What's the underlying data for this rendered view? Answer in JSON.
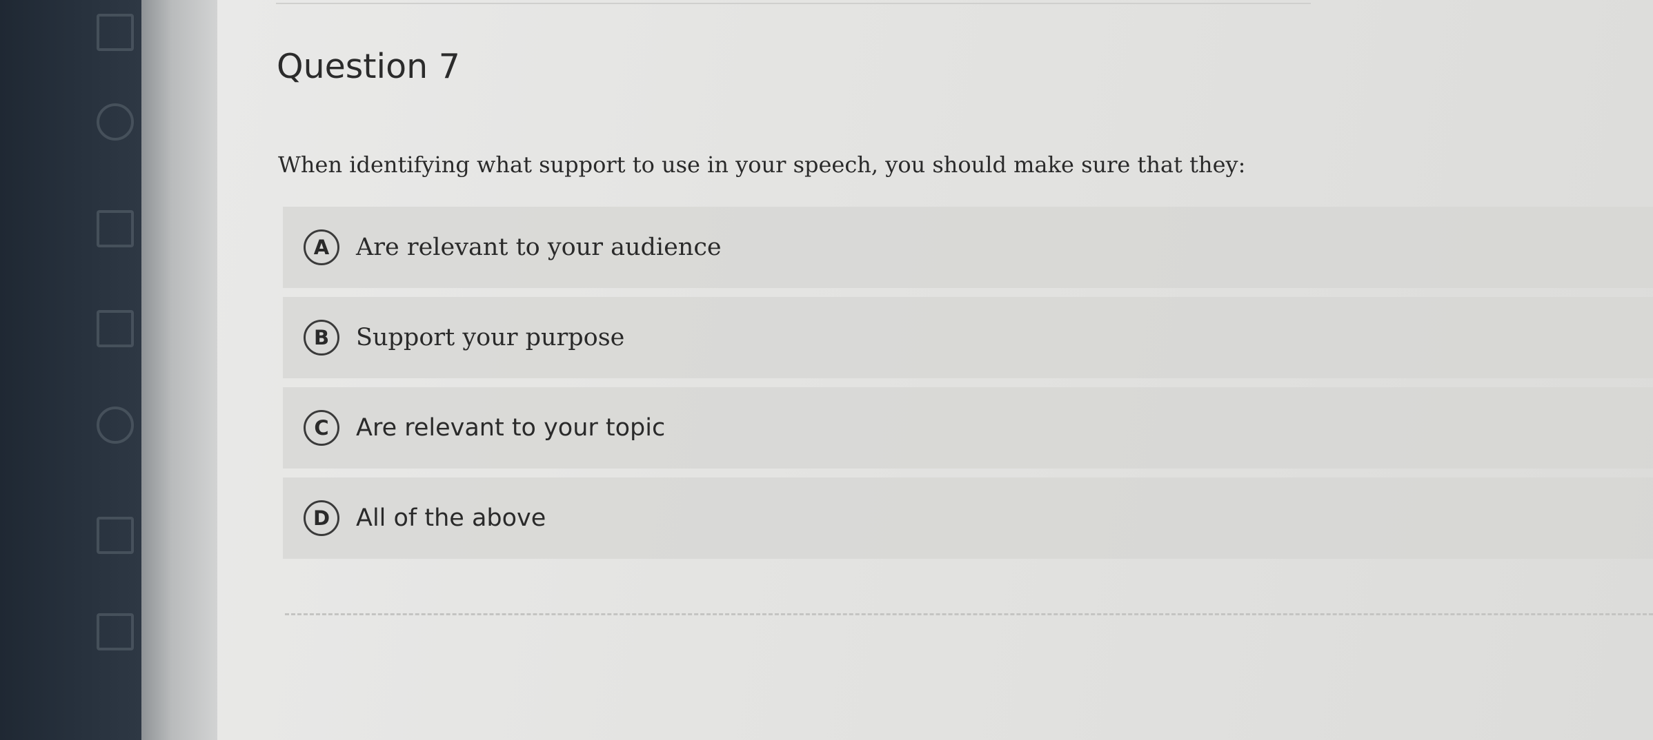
{
  "question": {
    "title": "Question 7",
    "prompt": "When identifying what support to use in your speech, you should make sure that they:"
  },
  "choices": [
    {
      "letter": "A",
      "label": "Are relevant to your audience"
    },
    {
      "letter": "B",
      "label": "Support your purpose"
    },
    {
      "letter": "C",
      "label": "Are relevant to your topic"
    },
    {
      "letter": "D",
      "label": "All of the above"
    }
  ],
  "colors": {
    "nav_background": "#27313d",
    "page_background": "#e6e6e4",
    "choice_background": "#d5d5d3",
    "text": "#2a2a2a"
  }
}
